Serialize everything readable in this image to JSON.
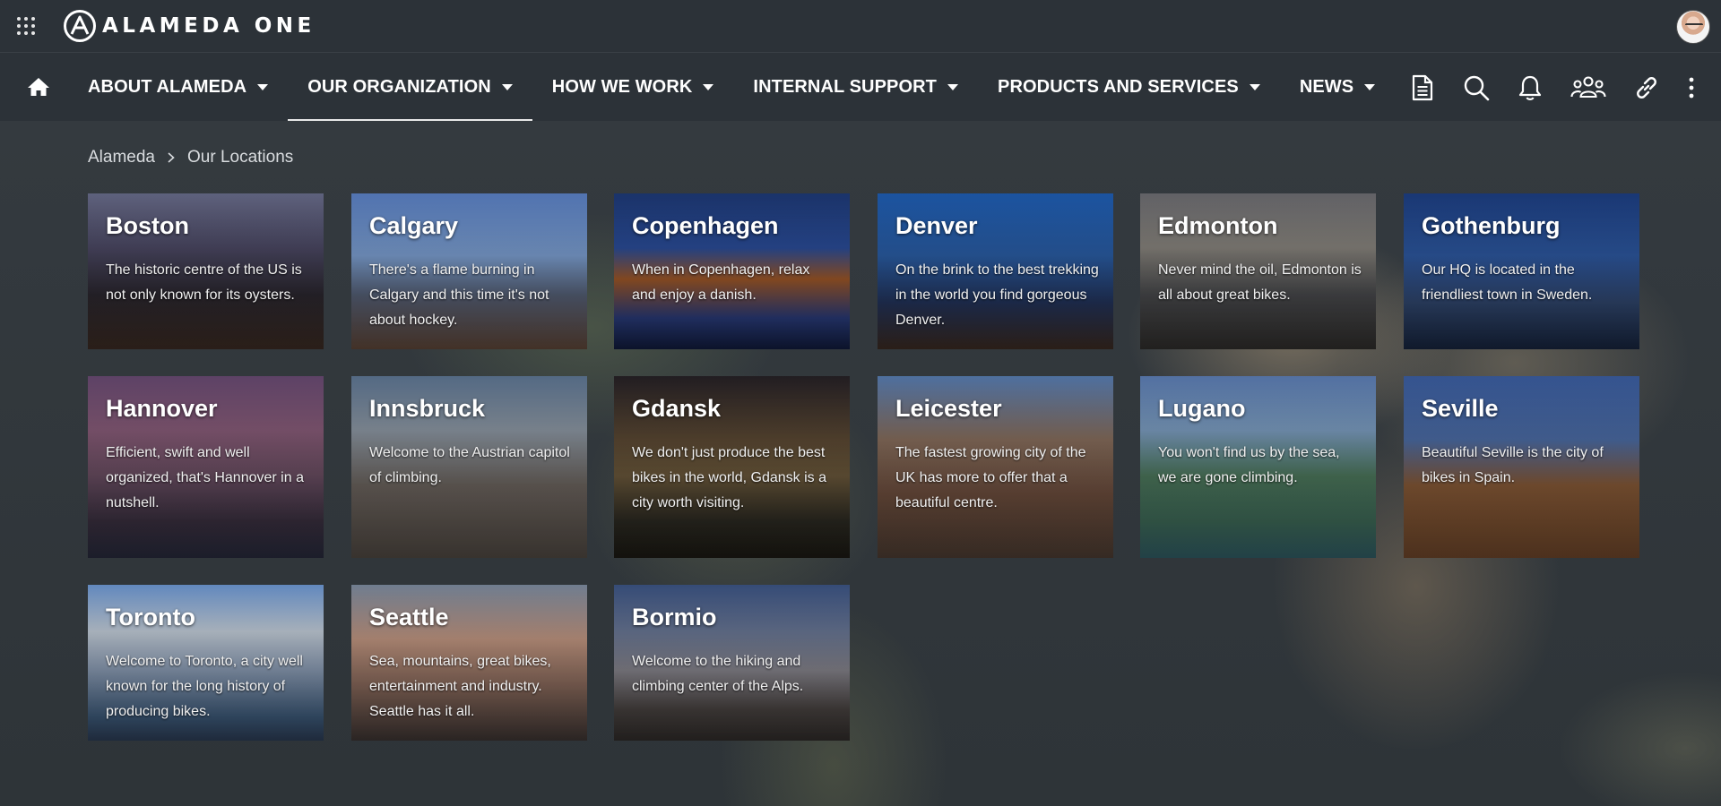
{
  "app": {
    "brand": "ALAMEDA ONE"
  },
  "nav": {
    "items": [
      {
        "label": "ABOUT ALAMEDA",
        "active": false
      },
      {
        "label": "OUR ORGANIZATION",
        "active": true
      },
      {
        "label": "HOW WE WORK",
        "active": false
      },
      {
        "label": "INTERNAL SUPPORT",
        "active": false
      },
      {
        "label": "PRODUCTS AND SERVICES",
        "active": false
      },
      {
        "label": "NEWS",
        "active": false
      }
    ],
    "tools": [
      "document-icon",
      "search-icon",
      "bell-icon",
      "people-icon",
      "link-icon",
      "more-vertical-icon"
    ]
  },
  "breadcrumb": {
    "root": "Alameda",
    "current": "Our Locations"
  },
  "locations": [
    {
      "name": "Boston",
      "text": "The historic centre of the US is not only known for its oysters."
    },
    {
      "name": "Calgary",
      "text": "There's a flame burning in Calgary and this time it's not about hockey."
    },
    {
      "name": "Copenhagen",
      "text": "When in Copenhagen, relax and enjoy a danish."
    },
    {
      "name": "Denver",
      "text": "On the brink to the best trekking in the world you find gorgeous Denver."
    },
    {
      "name": "Edmonton",
      "text": "Never mind the oil, Edmonton is all about great bikes."
    },
    {
      "name": "Gothenburg",
      "text": "Our HQ is located in the friendliest town in Sweden."
    },
    {
      "name": "Hannover",
      "text": "Efficient, swift and well organized, that's Hannover in a nutshell."
    },
    {
      "name": "Innsbruck",
      "text": "Welcome to the Austrian capitol of climbing."
    },
    {
      "name": "Gdansk",
      "text": "We don't just produce the best bikes in the world, Gdansk is a city worth visiting."
    },
    {
      "name": "Leicester",
      "text": "The fastest growing city of the UK has more to offer that a beautiful centre."
    },
    {
      "name": "Lugano",
      "text": "You won't find us by the sea, we are gone climbing."
    },
    {
      "name": "Seville",
      "text": "Beautiful Seville is the city of bikes in Spain."
    },
    {
      "name": "Toronto",
      "text": "Welcome to Toronto, a city well known for the long history of producing bikes."
    },
    {
      "name": "Seattle",
      "text": "Sea, mountains, great bikes, entertainment and industry. Seattle has it all."
    },
    {
      "name": "Bormio",
      "text": "Welcome to the hiking and climbing center of the Alps."
    }
  ]
}
